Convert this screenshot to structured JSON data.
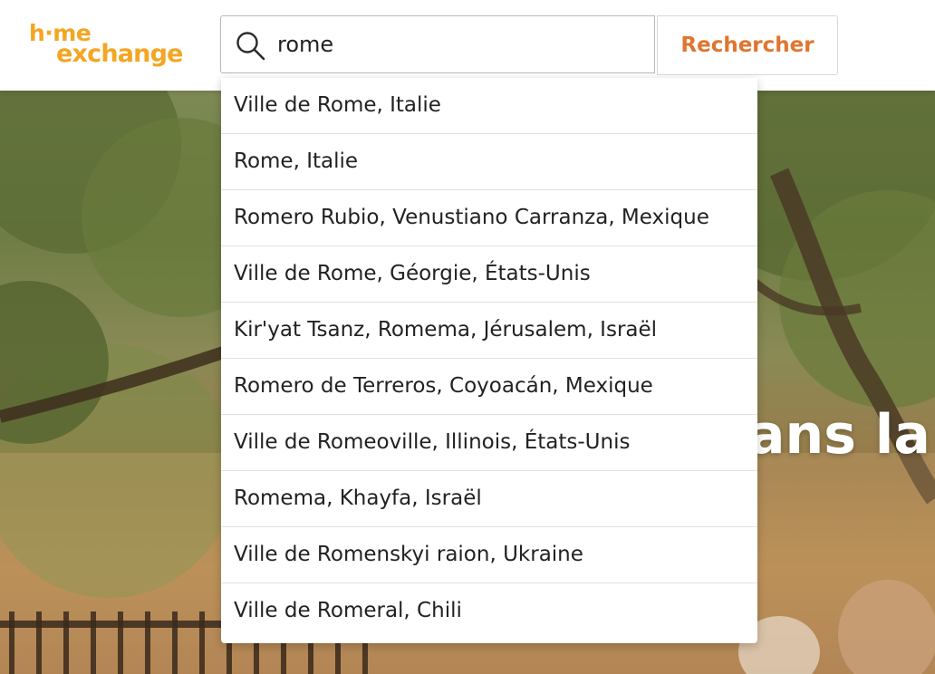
{
  "brand": {
    "logo_line1": "h·me",
    "logo_line2": "exchange",
    "accent_color": "#f3a623",
    "button_color": "#e0752f"
  },
  "search": {
    "value": "rome",
    "button_label": "Rechercher",
    "icon": "search-icon"
  },
  "suggestions": [
    "Ville de Rome, Italie",
    "Rome, Italie",
    "Romero Rubio, Venustiano Carranza, Mexique",
    "Ville de Rome, Géorgie, États-Unis",
    "Kir'yat Tsanz, Romema, Jérusalem, Israël",
    "Romero de Terreros, Coyoacán, Mexique",
    "Ville de Romeoville, Illinois, États-Unis",
    "Romema, Khayfa, Israël",
    "Ville de Romenskyi raion, Ukraine",
    "Ville de Romeral, Chili"
  ],
  "hero": {
    "partial_text": "ans la"
  }
}
